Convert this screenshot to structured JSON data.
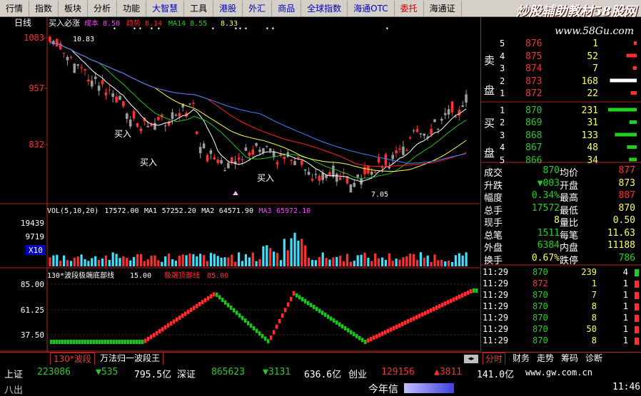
{
  "menu": [
    "行情",
    "指数",
    "板块",
    "分析",
    "功能",
    "大智慧",
    "工具",
    "港股",
    "外汇",
    "商品",
    "全球指数",
    "海通OTC",
    "委托",
    "海通证"
  ],
  "watermark": {
    "title": "炒股辅助教材58股网",
    "url": "www.58Gu.com"
  },
  "chart": {
    "period_label": "日线",
    "indicator_line": "买入必涨",
    "indicator_values": [
      {
        "label": "成本",
        "value": "8.50",
        "color": "#ff40ff"
      },
      {
        "label": "趋势",
        "value": "8.14",
        "color": "#ff2020"
      },
      {
        "label": "MA14",
        "value": "8.55",
        "color": "#20d020"
      },
      {
        "label": "",
        "value": "8.33",
        "color": "#ffff40"
      }
    ],
    "price_ticks": [
      "1083",
      "957",
      "832"
    ],
    "high_annotation": "10.83",
    "low_annotation": "7.05",
    "buy_labels": [
      "买入",
      "买入",
      "买入"
    ],
    "vol_legend": {
      "name": "VOL(5,10,20)",
      "vol": "17572.00",
      "ma1_label": "MA1",
      "ma1": "57252.20",
      "ma2_label": "MA2",
      "ma2": "64571.90",
      "ma3_label": "MA3",
      "ma3": "65972.10"
    },
    "vol_ticks": [
      "19439",
      "9719"
    ],
    "vol_unit": "X10",
    "osc_legend": {
      "name": "130*波段极端底部线",
      "v1": "15.00",
      "name2": "极端顶部线",
      "v2": "85.00"
    },
    "osc_ticks": [
      "85.00",
      "61.25",
      "37.50"
    ]
  },
  "order_book": {
    "sell_label": [
      "卖",
      "盘"
    ],
    "buy_label": [
      "买",
      "盘"
    ],
    "sells": [
      {
        "level": "5",
        "price": "876",
        "vol": "1"
      },
      {
        "level": "4",
        "price": "875",
        "vol": "52"
      },
      {
        "level": "3",
        "price": "874",
        "vol": "7"
      },
      {
        "level": "2",
        "price": "873",
        "vol": "168"
      },
      {
        "level": "1",
        "price": "872",
        "vol": "22"
      }
    ],
    "buys": [
      {
        "level": "1",
        "price": "870",
        "vol": "231"
      },
      {
        "level": "2",
        "price": "869",
        "vol": "31"
      },
      {
        "level": "3",
        "price": "868",
        "vol": "133"
      },
      {
        "level": "4",
        "price": "867",
        "vol": "48"
      },
      {
        "level": "5",
        "price": "866",
        "vol": "34"
      }
    ]
  },
  "stats": [
    {
      "l1": "成交",
      "v1": "870",
      "l2": "均价",
      "v2": "877"
    },
    {
      "l1": "升跌",
      "v1": "▼003",
      "l2": "开盘",
      "v2": "873"
    },
    {
      "l1": "幅度",
      "v1": "0.34%",
      "l2": "最高",
      "v2": "887"
    },
    {
      "l1": "总手",
      "v1": "17572",
      "l2": "最低",
      "v2": "870"
    },
    {
      "l1": "现手",
      "v1": "8",
      "l2": "量比",
      "v2": "0.50"
    },
    {
      "l1": "总笔",
      "v1": "1511",
      "l2": "每笔",
      "v2": "11.63"
    },
    {
      "l1": "外盘",
      "v1": "6384",
      "l2": "内盘",
      "v2": "11188"
    },
    {
      "l1": "换手",
      "v1": "0.67%",
      "l2": "跌停",
      "v2": "786"
    }
  ],
  "ticks": [
    {
      "time": "11:29",
      "price": "870",
      "vol": "239",
      "n": "4"
    },
    {
      "time": "11:29",
      "price": "872",
      "vol": "1",
      "n": "1"
    },
    {
      "time": "11:29",
      "price": "870",
      "vol": "7",
      "n": "1"
    },
    {
      "time": "11:29",
      "price": "870",
      "vol": "8",
      "n": "1"
    },
    {
      "time": "11:29",
      "price": "870",
      "vol": "8",
      "n": "1"
    },
    {
      "time": "11:29",
      "price": "870",
      "vol": "50",
      "n": "1"
    },
    {
      "time": "11:29",
      "price": "870",
      "vol": "8",
      "n": "1"
    }
  ],
  "bottom_tabs": {
    "left": [
      "130*波段",
      "万法归一波段王"
    ],
    "right": [
      "分时",
      "财务",
      "走势",
      "筹码",
      "诊断"
    ]
  },
  "status": {
    "sh_label": "上证",
    "sh_index": "223086",
    "sh_chg": "▼535",
    "sh_amt": "795.5亿",
    "sz_label": "深证",
    "sz_index": "865623",
    "sz_chg": "▼3131",
    "sz_amt": "636.6亿",
    "cy_label": "创业",
    "cy_index": "129156",
    "cy_chg": "▲3811",
    "cy_amt": "141.0亿",
    "site": "www.gw.com.cn"
  },
  "footer": {
    "left": "八出",
    "center": "今年信",
    "time": "11:46"
  }
}
